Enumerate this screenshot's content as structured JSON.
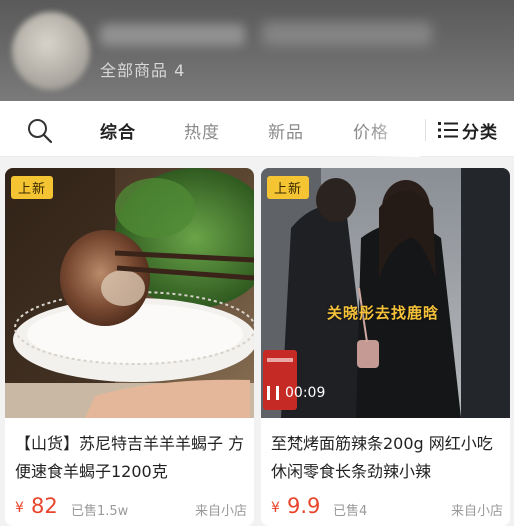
{
  "shop": {
    "all_items_label": "全部商品 4"
  },
  "sort_bar": {
    "tabs": [
      {
        "label": "综合",
        "active": true
      },
      {
        "label": "热度",
        "active": false
      },
      {
        "label": "新品",
        "active": false
      },
      {
        "label": "价格",
        "active": false
      }
    ],
    "category_label": "分类"
  },
  "products": [
    {
      "badge": "上新",
      "title": "【山货】苏尼特吉羊羊羊蝎子 方便速食羊蝎子1200克",
      "price_symbol": "¥",
      "price": "82",
      "sold": "已售1.5w",
      "source": "来自小店"
    },
    {
      "badge": "上新",
      "title": "至梵烤面筋辣条200g 网红小吃休闲零食长条劲辣小辣",
      "price_symbol": "¥",
      "price": "9.9",
      "sold": "已售4",
      "source": "来自小店",
      "video_caption": "关晓彤去找鹿晗",
      "video_duration": "00:09"
    }
  ],
  "colors": {
    "price": "#e8452c",
    "badge": "#f4c433",
    "caption": "#f6c23a"
  },
  "icons": [
    "search-icon",
    "list-icon",
    "play-pause-icon"
  ]
}
